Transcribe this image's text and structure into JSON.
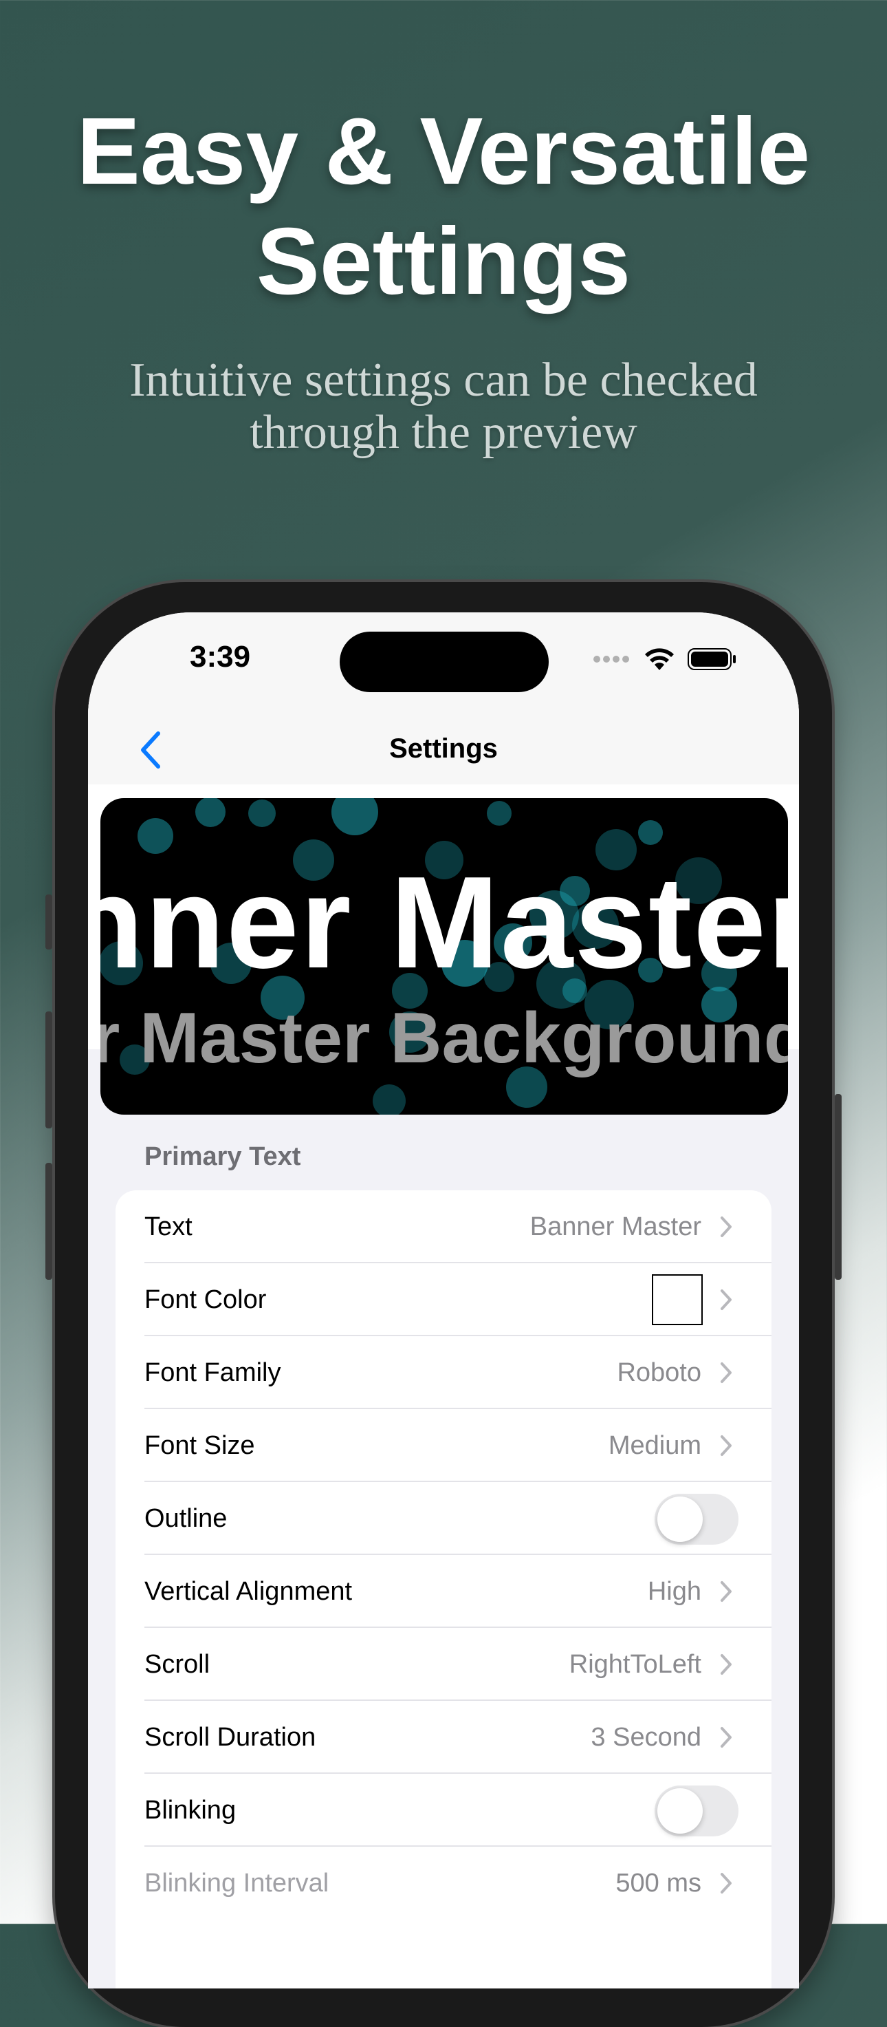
{
  "headline": {
    "line1": "Easy & Versatile",
    "line2": "Settings"
  },
  "subheadline": {
    "line1": "Intuitive settings can be checked",
    "line2": "through the preview"
  },
  "status_bar": {
    "time": "3:39"
  },
  "nav": {
    "title": "Settings",
    "back_icon": "chevron-left-icon"
  },
  "preview": {
    "big_text": "Banner Master",
    "small_text": "Banner Master Background Setup"
  },
  "colors": {
    "accent": "#0a7aff",
    "bubble": "#1fb6c6"
  },
  "section": {
    "header": "Primary Text",
    "rows": [
      {
        "label": "Text",
        "value": "Banner Master"
      },
      {
        "label": "Font Color",
        "value": ""
      },
      {
        "label": "Font Family",
        "value": "Roboto"
      },
      {
        "label": "Font Size",
        "value": "Medium"
      },
      {
        "label": "Outline",
        "value": ""
      },
      {
        "label": "Vertical Alignment",
        "value": "High"
      },
      {
        "label": "Scroll",
        "value": "RightToLeft"
      },
      {
        "label": "Scroll Duration",
        "value": "3 Second"
      },
      {
        "label": "Blinking",
        "value": ""
      },
      {
        "label": "Blinking Interval",
        "value": "500 ms"
      }
    ]
  }
}
